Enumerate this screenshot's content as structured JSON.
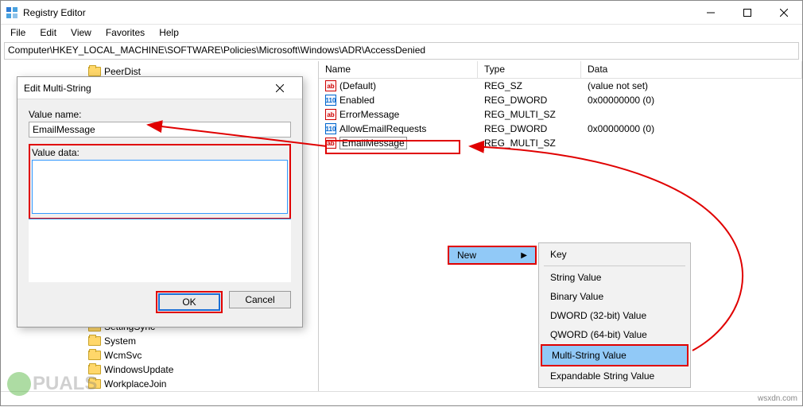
{
  "window": {
    "title": "Registry Editor",
    "address": "Computer\\HKEY_LOCAL_MACHINE\\SOFTWARE\\Policies\\Microsoft\\Windows\\ADR\\AccessDenied"
  },
  "menu": {
    "file": "File",
    "edit": "Edit",
    "view": "View",
    "favorites": "Favorites",
    "help": "Help"
  },
  "tree": {
    "items": [
      "PeerDist",
      "SettingSync",
      "System",
      "WcmSvc",
      "WindowsUpdate",
      "WorkplaceJoin"
    ]
  },
  "columns": {
    "name": "Name",
    "type": "Type",
    "data": "Data"
  },
  "values": [
    {
      "icon": "sz",
      "name": "(Default)",
      "type": "REG_SZ",
      "data": "(value not set)"
    },
    {
      "icon": "dw",
      "name": "Enabled",
      "type": "REG_DWORD",
      "data": "0x00000000 (0)"
    },
    {
      "icon": "sz",
      "name": "ErrorMessage",
      "type": "REG_MULTI_SZ",
      "data": ""
    },
    {
      "icon": "dw",
      "name": "AllowEmailRequests",
      "type": "REG_DWORD",
      "data": "0x00000000 (0)"
    },
    {
      "icon": "sz",
      "name": "EmailMessage",
      "type": "REG_MULTI_SZ",
      "data": "",
      "editing": true
    }
  ],
  "dialog": {
    "title": "Edit Multi-String",
    "value_name_label": "Value name:",
    "value_name": "EmailMessage",
    "value_data_label": "Value data:",
    "value_data": "",
    "ok": "OK",
    "cancel": "Cancel"
  },
  "context": {
    "new": "New",
    "items": [
      "Key",
      "String Value",
      "Binary Value",
      "DWORD (32-bit) Value",
      "QWORD (64-bit) Value",
      "Multi-String Value",
      "Expandable String Value"
    ]
  },
  "branding": {
    "watermark": "PUALS",
    "credit": "wsxdn.com"
  }
}
